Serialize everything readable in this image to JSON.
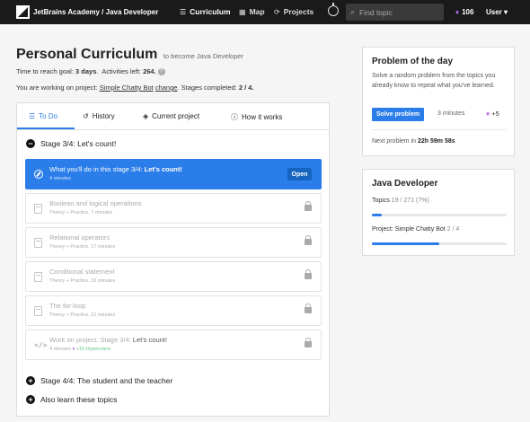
{
  "nav": {
    "brand": "JetBrains Academy / Java Developer",
    "curriculum": "Curriculum",
    "map": "Map",
    "projects": "Projects",
    "search_placeholder": "Find topic",
    "gems": "106",
    "user": "User"
  },
  "header": {
    "title": "Personal Curriculum",
    "subtitle": "to become Java Developer",
    "time_label": "Time to reach goal:",
    "time_value": "3 days",
    "activities_label": "Activities left:",
    "activities_value": "264.",
    "project_label": "You are working on project:",
    "project_name": "Simple Chatty Bot",
    "change": "change",
    "stages_label": "Stages completed:",
    "stages_value": "2 / 4."
  },
  "tabs": [
    {
      "label": "To Do",
      "icon": "list-icon"
    },
    {
      "label": "History",
      "icon": "history-icon"
    },
    {
      "label": "Current project",
      "icon": "box-icon"
    },
    {
      "label": "How it works",
      "icon": "info-icon"
    }
  ],
  "stage_current": "Stage 3/4: Let's count!",
  "topics": [
    {
      "title_prefix": "What you'll do in this stage 3/4:",
      "title_bold": "Let's count!",
      "sub": "4 minutes",
      "action": "Open"
    },
    {
      "title": "Boolean and logical operations",
      "sub": "Theory + Practice, 7 minutes"
    },
    {
      "title": "Relational operators",
      "sub": "Theory + Practice, 17 minutes"
    },
    {
      "title": "Conditional statement",
      "sub": "Theory + Practice, 32 minutes"
    },
    {
      "title": "The for-loop",
      "sub": "Theory + Practice, 21 minutes"
    },
    {
      "title": "Work on project. Stage 3/4:",
      "title_dark": "Let's count!",
      "sub": "4 minutes",
      "sub_extra": "+15 Hypercoins"
    }
  ],
  "stage_next": "Stage 4/4: The student and the teacher",
  "also_learn": "Also learn these topics",
  "potd": {
    "title": "Problem of the day",
    "desc": "Solve a random problem from the topics you already know to repeat what you've learned.",
    "button": "Solve problem",
    "minutes": "3 minutes",
    "reward": "+5",
    "next_label": "Next problem in",
    "next_value": "22h 59m 58s"
  },
  "track": {
    "title": "Java Developer",
    "topics_label": "Topics",
    "topics_value": "19 / 271 (7%)",
    "topics_progress": 0.07,
    "project_label": "Project: Simple Chatty Bot",
    "project_value": "2 / 4",
    "project_progress": 0.5
  },
  "colors": {
    "accent": "#2b7de9",
    "topbar": "#1a1a1a",
    "gem": "#b06ce8"
  }
}
